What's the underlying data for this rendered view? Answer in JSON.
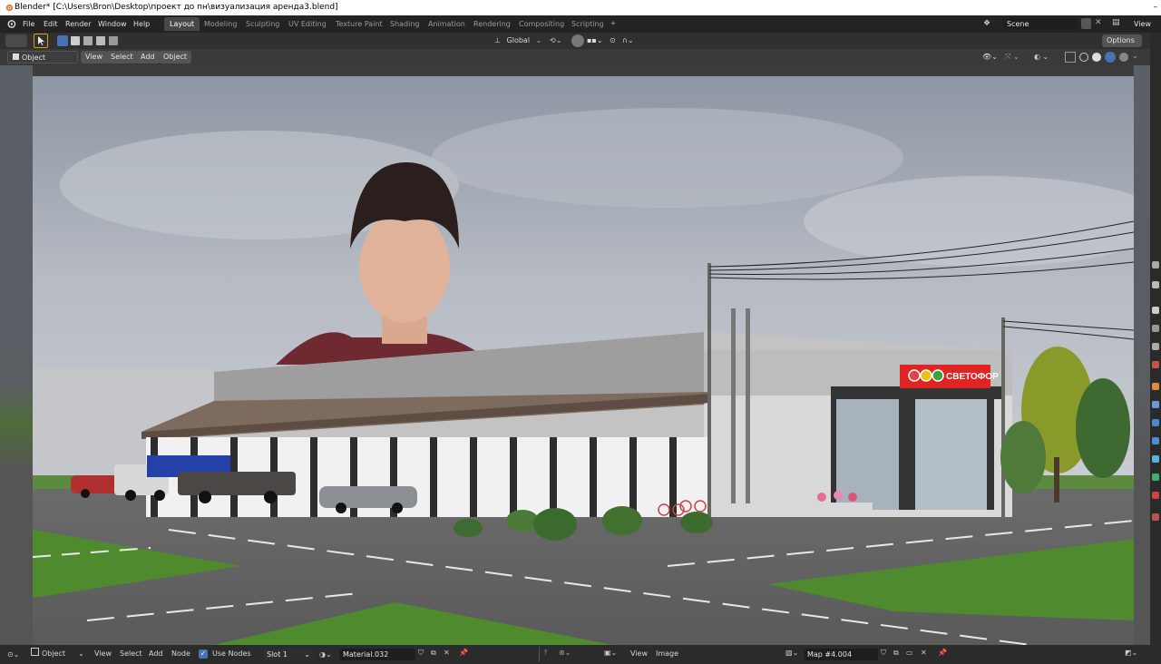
{
  "window": {
    "title": "Blender* [C:\\Users\\Bron\\Desktop\\проект до пн\\визуализация аренда3.blend]"
  },
  "menubar": {
    "menus": [
      "File",
      "Edit",
      "Render",
      "Window",
      "Help"
    ],
    "workspaces": [
      "Layout",
      "Modeling",
      "Sculpting",
      "UV Editing",
      "Texture Paint",
      "Shading",
      "Animation",
      "Rendering",
      "Compositing",
      "Scripting"
    ],
    "active_workspace": "Layout",
    "scene": "Scene",
    "view_layer": "View La"
  },
  "tool_header": {
    "orientation": "Global",
    "options": "Options"
  },
  "view_header": {
    "mode": "Object Mode",
    "menus": [
      "View",
      "Select",
      "Add",
      "Object"
    ]
  },
  "sign": {
    "store_name": "СВЕТОФОР"
  },
  "bottombar": {
    "editor_type": "Object",
    "menus": [
      "View",
      "Select",
      "Add",
      "Node"
    ],
    "use_nodes_label": "Use Nodes",
    "use_nodes_checked": true,
    "slot": "Slot 1",
    "material": "Material.032",
    "image_menus": [
      "View",
      "Image"
    ],
    "image_name": "Map #4.004"
  },
  "icons": [
    "blender-logo-icon",
    "cursor-tool-icon",
    "select-box-icon",
    "orientation-icon",
    "snap-icon",
    "proportional-edit-icon",
    "view-shading-icon",
    "overlay-icon",
    "gizmo-icon",
    "pin-icon",
    "checkbox-icon",
    "close-icon",
    "new-file-icon"
  ],
  "colors": {
    "titlebar": "#ffffff",
    "menubar": "#232323",
    "active_tab": "#474747",
    "header": "#303030",
    "accent_blue": "#4772b3",
    "sign_red": "#e02424"
  }
}
